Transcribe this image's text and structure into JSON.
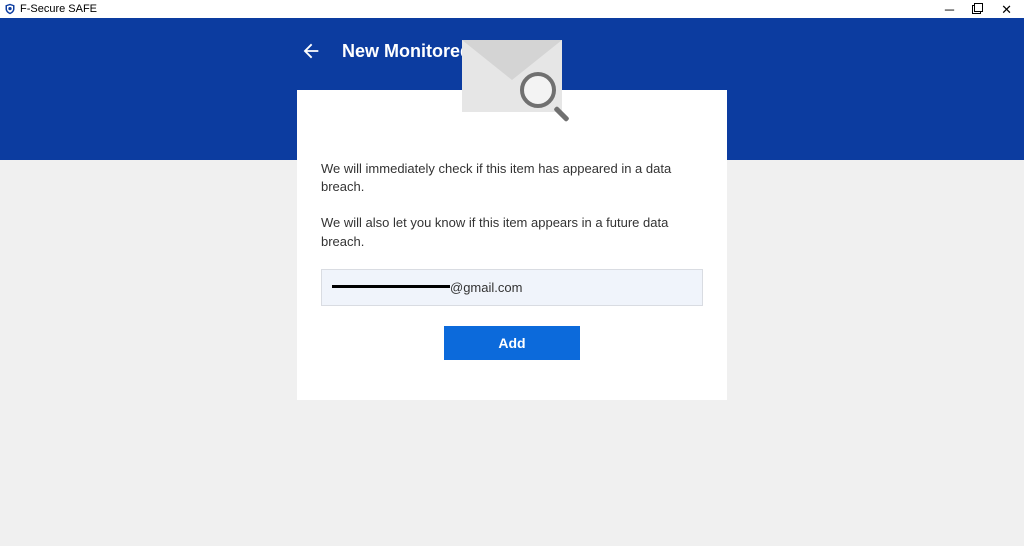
{
  "window": {
    "title": "F-Secure SAFE"
  },
  "header": {
    "title": "New Monitored Item"
  },
  "main": {
    "info1": "We will immediately check if this item has appeared in a data breach.",
    "info2": "We will also let you know if this item appears in a future data breach.",
    "email_visible_suffix": "@gmail.com",
    "add_button": "Add"
  },
  "icons": {
    "back": "back-arrow-icon",
    "envelope": "envelope-search-icon"
  },
  "colors": {
    "header_bg": "#0c3ca0",
    "button_bg": "#0c6adb"
  }
}
